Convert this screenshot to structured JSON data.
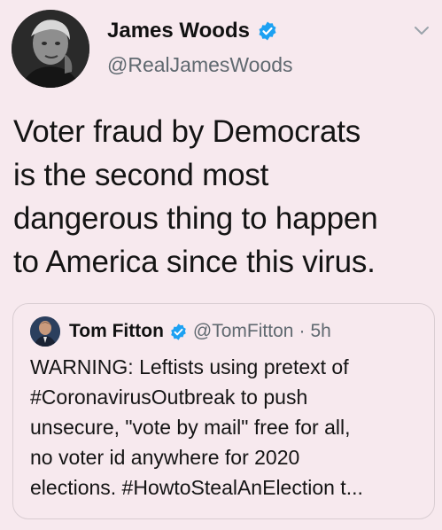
{
  "tweet": {
    "author": {
      "display_name": "James Woods",
      "handle": "@RealJamesWoods",
      "verified": true,
      "avatar_icon": "profile-photo"
    },
    "text": "Voter fraud by Democrats\nis the second most\ndangerous thing to happen\nto America since this virus.",
    "menu_icon": "chevron-down-icon"
  },
  "quoted_tweet": {
    "author": {
      "display_name": "Tom Fitton",
      "handle": "@TomFitton",
      "verified": true
    },
    "separator": "·",
    "time": "5h",
    "text": "WARNING: Leftists using pretext of\n#CoronavirusOutbreak to push\nunsecure, \"vote by mail\" free for all,\nno voter id anywhere for 2020\nelections. #HowtoStealAnElection t..."
  },
  "colors": {
    "background": "#f7e9ee",
    "verified_badge": "#1da1f2",
    "secondary_text": "#606970",
    "card_border": "#d9cdd2"
  }
}
